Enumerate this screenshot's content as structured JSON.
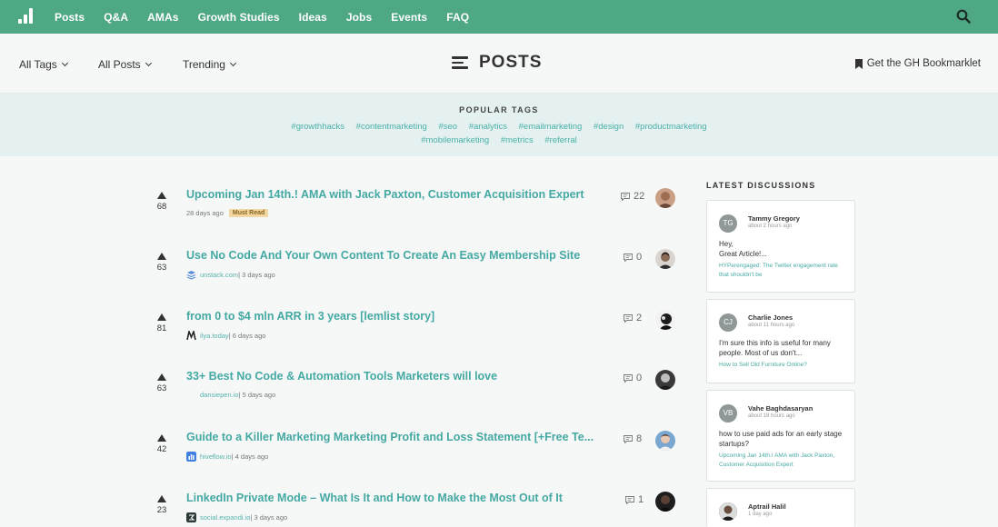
{
  "nav": {
    "items": [
      "Posts",
      "Q&A",
      "AMAs",
      "Growth Studies",
      "Ideas",
      "Jobs",
      "Events",
      "FAQ"
    ]
  },
  "filters": {
    "tags": "All Tags",
    "posts": "All Posts",
    "sort": "Trending"
  },
  "page_title": "POSTS",
  "bookmarklet": "Get the GH Bookmarklet",
  "popular_tags": {
    "heading": "POPULAR TAGS",
    "row1": [
      "#growthhacks",
      "#contentmarketing",
      "#seo",
      "#analytics",
      "#emailmarketing",
      "#design",
      "#productmarketing"
    ],
    "row2": [
      "#mobilemarketing",
      "#metrics",
      "#referral"
    ]
  },
  "posts": [
    {
      "title": "Upcoming Jan 14th.! AMA with Jack Paxton, Customer Acquisition Expert",
      "votes": "68",
      "source": "",
      "time": "28 days ago",
      "badge": "Must Read",
      "comments": "22"
    },
    {
      "title": "Use No Code And Your Own Content To Create An Easy Membership Site",
      "votes": "63",
      "source": "unstack.com",
      "time": " | 3 days ago",
      "comments": "0"
    },
    {
      "title": "from 0 to $4 mln ARR in 3 years [lemlist story]",
      "votes": "81",
      "source": "ilya.today",
      "time": " | 6 days ago",
      "comments": "2"
    },
    {
      "title": "33+ Best No Code & Automation Tools Marketers will love",
      "votes": "63",
      "source": "dansiepen.io",
      "time": " | 5 days ago",
      "comments": "0"
    },
    {
      "title": "Guide to a Killer Marketing Marketing Profit and Loss Statement [+Free Te...",
      "votes": "42",
      "source": "hiveflow.io",
      "time": " | 4 days ago",
      "comments": "8"
    },
    {
      "title": "LinkedIn Private Mode – What Is It and How to Make the Most Out of It",
      "votes": "23",
      "source": "social.expandi.io",
      "time": " | 3 days ago",
      "comments": "1"
    }
  ],
  "sidebar": {
    "title": "LATEST DISCUSSIONS",
    "discussions": [
      {
        "initials": "TG",
        "name": "Tammy Gregory",
        "time": "about 2 hours ago",
        "body1": "Hey,",
        "body2": "Great Article!...",
        "link": "HYPerengaged: The Twitter engagement rate that shouldn't be"
      },
      {
        "initials": "CJ",
        "name": "Charlie Jones",
        "time": "about 11 hours ago",
        "body1": "I'm sure this info is useful for many people. Most of us don't...",
        "body2": "",
        "link": "How to Sell Old Furniture Online?"
      },
      {
        "initials": "VB",
        "name": "Vahe Baghdasaryan",
        "time": "about 18 hours ago",
        "body1": "how to use paid ads for an early stage startups?",
        "body2": "",
        "link": "Upcoming Jan 14th.! AMA with Jack Paxton, Customer Acquisition Expert"
      },
      {
        "initials": "",
        "name": "Aptrail Halil",
        "time": "1 day ago",
        "body1": "",
        "body2": "",
        "link": ""
      }
    ]
  }
}
